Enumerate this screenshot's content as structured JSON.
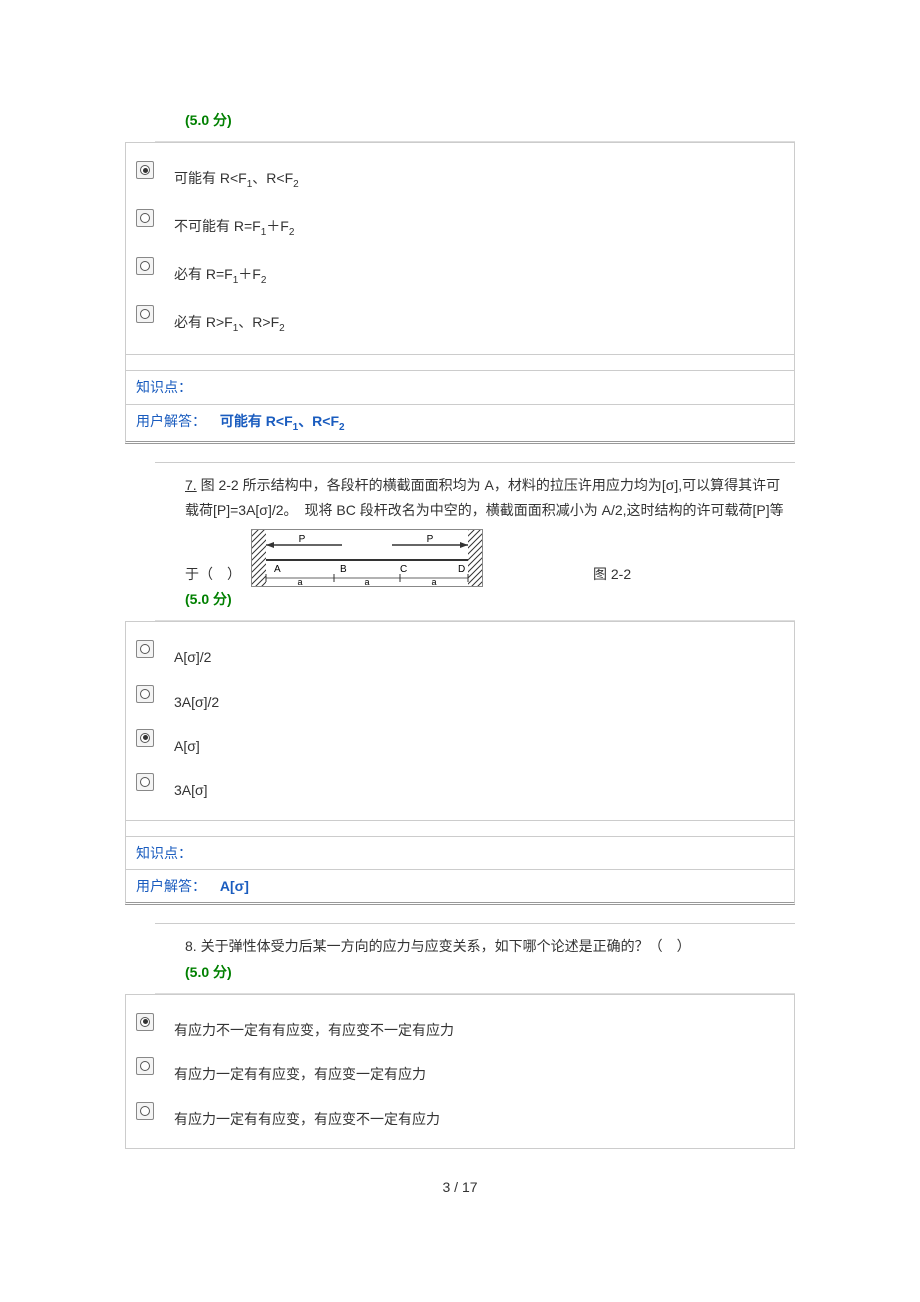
{
  "q6": {
    "score": "(5.0 分)",
    "options": [
      {
        "text_prefix": "可能有 R<F",
        "sub1": "1",
        "mid": "、R<F",
        "sub2": "2",
        "selected": true
      },
      {
        "text_prefix": "不可能有 R=F",
        "sub1": "1",
        "mid": "＋F",
        "sub2": "2",
        "selected": false
      },
      {
        "text_prefix": "必有 R=F",
        "sub1": "1",
        "mid": "＋F",
        "sub2": "2",
        "selected": false
      },
      {
        "text_prefix": "必有 R>F",
        "sub1": "1",
        "mid": "、R>F",
        "sub2": "2",
        "selected": false
      }
    ],
    "meta_label1": "知识点：",
    "meta_label2": "用户解答：",
    "answer_prefix": "可能有 ",
    "answer_bold": "R<F",
    "answer_sub1": "1",
    "answer_mid": "、R<F",
    "answer_sub2": "2"
  },
  "q7": {
    "num": "7.",
    "text1": "图 2-2 所示结构中，各段杆的横截面面积均为 A，材料的拉压许用应力均为[σ],可以算得其许可载荷[P]=3A[σ]/2。　现将 BC 段杆改名为中空的，横截面面积减小为 A/2,这时结构的许可载荷[P]等",
    "text2_pre": "于（　）",
    "fig_label": "图 2-2",
    "score": "(5.0 分)",
    "options": [
      {
        "text": "A[σ]/2",
        "selected": false
      },
      {
        "text": "3A[σ]/2",
        "selected": false
      },
      {
        "text": "A[σ]",
        "selected": true
      },
      {
        "text": "3A[σ]",
        "selected": false
      }
    ],
    "meta_label1": "知识点：",
    "meta_label2": "用户解答：",
    "answer": "A[σ]"
  },
  "q8": {
    "num": "8.",
    "text": "关于弹性体受力后某一方向的应力与应变关系，如下哪个论述是正确的？（　）",
    "score": "(5.0 分)",
    "options": [
      {
        "text": "有应力不一定有有应变，有应变不一定有应力",
        "selected": true
      },
      {
        "text": "有应力一定有有应变，有应变一定有应力",
        "selected": false
      },
      {
        "text": "有应力一定有有应变，有应变不一定有应力",
        "selected": false
      }
    ]
  },
  "page_num": "3 / 17"
}
